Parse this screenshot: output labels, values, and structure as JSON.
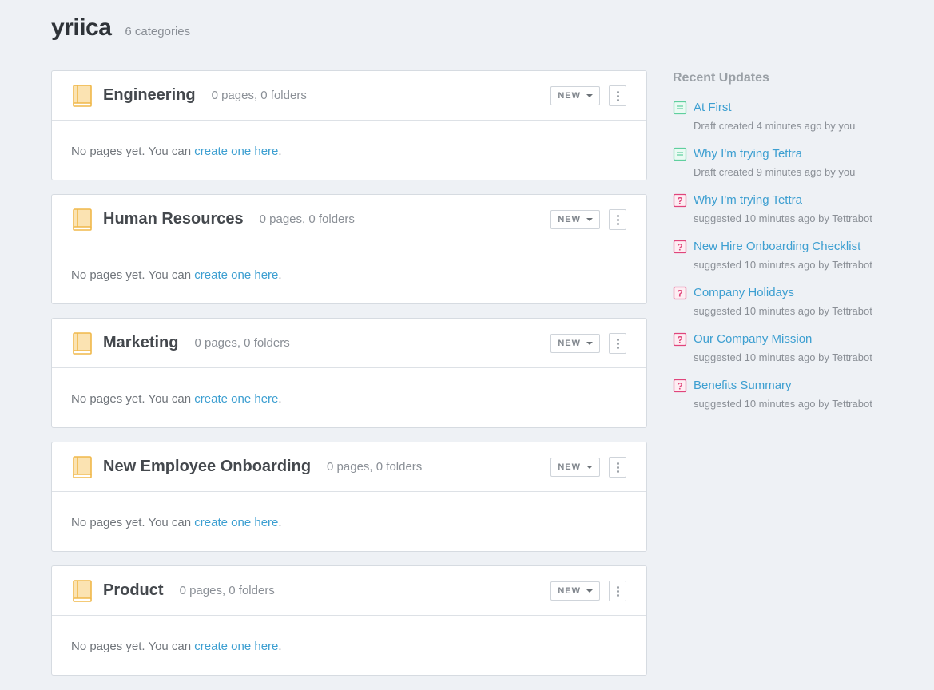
{
  "header": {
    "title": "yriica",
    "count": "6 categories"
  },
  "categories": [
    {
      "name": "Engineering",
      "meta": "0 pages, 0 folders",
      "new_label": "NEW",
      "empty_text": "No pages yet. You can ",
      "empty_link": "create one here",
      "empty_end": "."
    },
    {
      "name": "Human Resources",
      "meta": "0 pages, 0 folders",
      "new_label": "NEW",
      "empty_text": "No pages yet. You can ",
      "empty_link": "create one here",
      "empty_end": "."
    },
    {
      "name": "Marketing",
      "meta": "0 pages, 0 folders",
      "new_label": "NEW",
      "empty_text": "No pages yet. You can ",
      "empty_link": "create one here",
      "empty_end": "."
    },
    {
      "name": "New Employee Onboarding",
      "meta": "0 pages, 0 folders",
      "new_label": "NEW",
      "empty_text": "No pages yet. You can ",
      "empty_link": "create one here",
      "empty_end": "."
    },
    {
      "name": "Product",
      "meta": "0 pages, 0 folders",
      "new_label": "NEW",
      "empty_text": "No pages yet. You can ",
      "empty_link": "create one here",
      "empty_end": "."
    }
  ],
  "updates": {
    "heading": "Recent Updates",
    "items": [
      {
        "icon": "draft-page-icon",
        "title": "At First",
        "sub": "Draft created 4 minutes ago by you"
      },
      {
        "icon": "draft-page-icon",
        "title": "Why I'm trying Tettra",
        "sub": "Draft created 9 minutes ago by you"
      },
      {
        "icon": "suggestion-icon",
        "title": "Why I'm trying Tettra",
        "sub": "suggested 10 minutes ago by Tettrabot"
      },
      {
        "icon": "suggestion-icon",
        "title": "New Hire Onboarding Checklist",
        "sub": "suggested 10 minutes ago by Tettrabot"
      },
      {
        "icon": "suggestion-icon",
        "title": "Company Holidays",
        "sub": "suggested 10 minutes ago by Tettrabot"
      },
      {
        "icon": "suggestion-icon",
        "title": "Our Company Mission",
        "sub": "suggested 10 minutes ago by Tettrabot"
      },
      {
        "icon": "suggestion-icon",
        "title": "Benefits Summary",
        "sub": "suggested 10 minutes ago by Tettrabot"
      }
    ]
  },
  "colors": {
    "accent": "#3d9fd1",
    "book": "#f0b84a",
    "draft": "#5fcf9e",
    "suggest": "#e0457b"
  }
}
